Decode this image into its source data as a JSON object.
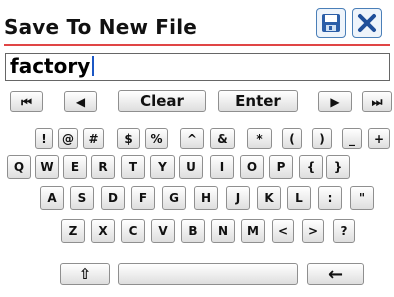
{
  "header": {
    "title": "Save To New File",
    "save_icon": "save-disk-icon",
    "close_icon": "close-x-icon"
  },
  "input": {
    "value": "factory"
  },
  "nav_row": {
    "first": "⏮",
    "prev": "◀",
    "clear": "Clear",
    "enter": "Enter",
    "next": "▶",
    "last": "⏭"
  },
  "symbols": [
    "!",
    "@",
    "#",
    "$",
    "%",
    "^",
    "&",
    "*",
    "(",
    ")",
    "_",
    "+"
  ],
  "row_q": [
    "Q",
    "W",
    "E",
    "R",
    "T",
    "Y",
    "U",
    "I",
    "O",
    "P",
    "{",
    "}"
  ],
  "row_a": [
    "A",
    "S",
    "D",
    "F",
    "G",
    "H",
    "J",
    "K",
    "L",
    ":",
    "\""
  ],
  "row_z": [
    "Z",
    "X",
    "C",
    "V",
    "B",
    "N",
    "M",
    "<",
    ">",
    "?"
  ],
  "bottom": {
    "shift": "⇧",
    "backspace": "←"
  },
  "colors": {
    "accent_red": "#e04545",
    "icon_blue": "#1f4f9a"
  }
}
